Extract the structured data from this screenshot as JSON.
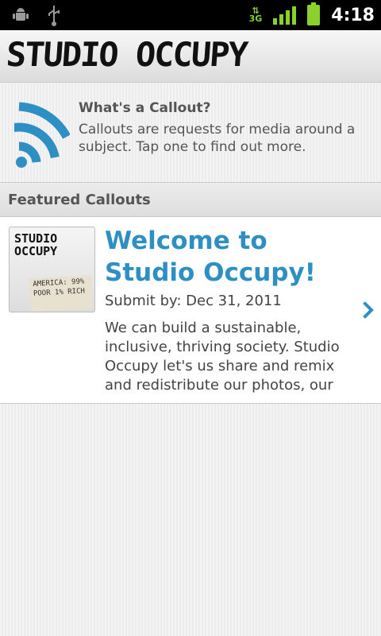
{
  "status_bar": {
    "time": "4:18",
    "network": "3G",
    "icons": [
      "android-debug-icon",
      "usb-icon",
      "data-transfer-icon",
      "signal-icon",
      "battery-icon"
    ],
    "accent": "#8bd12b"
  },
  "app": {
    "logo": "STUDIO OCCUPY"
  },
  "info": {
    "title": "What's a Callout?",
    "description": "Callouts are requests for media around a subject. Tap one to find out more.",
    "icon": "wifi-broadcast-icon",
    "icon_color": "#2d8fc4"
  },
  "featured": {
    "header": "Featured Callouts",
    "items": [
      {
        "title": "Welcome to Studio Occupy!",
        "submit_by": "Submit by: Dec 31, 2011",
        "description": "We can build a sustainable, inclusive, thriving society. Studio Occupy let's us share and remix and redistribute our photos, our",
        "thumb_text": "STUDIO OCCUPY",
        "sign_text": "AMERICA: 99% POOR 1% RICH",
        "accent": "#2d8fc4"
      }
    ]
  }
}
